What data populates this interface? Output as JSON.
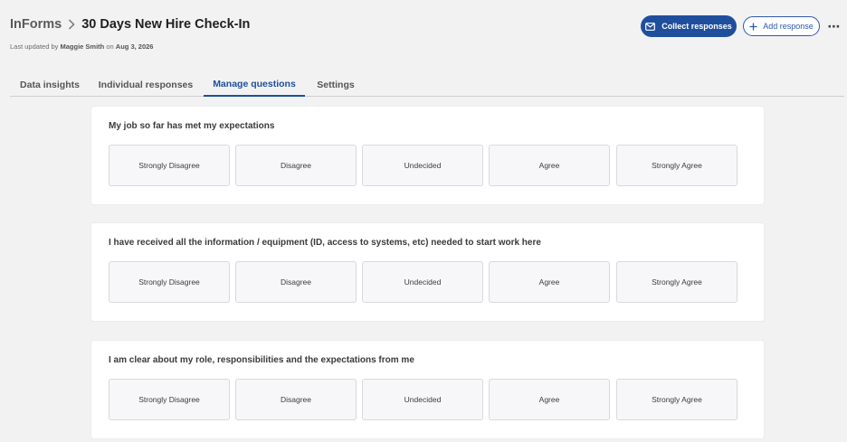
{
  "breadcrumb": {
    "root": "InForms",
    "title": "30 Days New Hire Check-In"
  },
  "meta": {
    "prefix": "Last updated by",
    "user": "Maggie Smith",
    "on": "on",
    "date": "Aug 3, 2026"
  },
  "actions": {
    "collect_label": "Collect responses",
    "add_label": "Add response",
    "more_label": "⋯"
  },
  "tabs": [
    {
      "label": "Data insights"
    },
    {
      "label": "Individual responses"
    },
    {
      "label": "Manage questions"
    },
    {
      "label": "Settings"
    }
  ],
  "active_tab": "Manage questions",
  "questions": [
    {
      "title": "My job so far has met my expectations",
      "options": [
        "Strongly Disagree",
        "Disagree",
        "Undecided",
        "Agree",
        "Strongly Agree"
      ]
    },
    {
      "title": "I have received all the information / equipment (ID, access to systems, etc) needed to start work here",
      "options": [
        "Strongly Disagree",
        "Disagree",
        "Undecided",
        "Agree",
        "Strongly Agree"
      ]
    },
    {
      "title": "I am clear about my role, responsibilities and the expectations from me",
      "options": [
        "Strongly Disagree",
        "Disagree",
        "Undecided",
        "Agree",
        "Strongly Agree"
      ]
    }
  ],
  "colors": {
    "brand": "#1f4f9c",
    "background": "#f2f2f3",
    "card": "#ffffff",
    "option_bg": "#f7f7f9"
  },
  "icons": {
    "collect": "envelope-icon",
    "add": "plus-icon",
    "breadcrumb_separator": "chevron-right-icon"
  }
}
